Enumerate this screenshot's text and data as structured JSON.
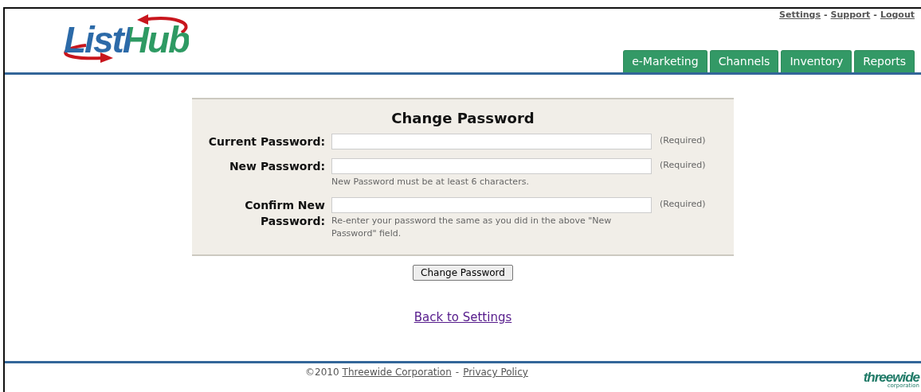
{
  "header": {
    "logo": "ListHub",
    "top_links": [
      {
        "label": "Settings"
      },
      {
        "label": "Support"
      },
      {
        "label": "Logout"
      }
    ],
    "link_separator": "-",
    "tabs": [
      {
        "label": "e-Marketing",
        "selected": false
      },
      {
        "label": "Channels",
        "selected": false
      },
      {
        "label": "Inventory",
        "selected": false
      },
      {
        "label": "Reports",
        "selected": false
      }
    ]
  },
  "form": {
    "title": "Change Password",
    "fields": [
      {
        "label": "Current Password:",
        "required_note": "(Required)"
      },
      {
        "label": "New Password:",
        "required_note": "(Required)",
        "hint": "New Password must be at least 6 characters."
      },
      {
        "label": "Confirm New Password:",
        "required_note": "(Required)",
        "hint": "Re-enter your password the same as you did in the above \"New Password\" field."
      }
    ],
    "submit": "Change Password"
  },
  "back_link": "Back to Settings",
  "footer": {
    "copyright": "©2010",
    "company_link": "Threewide Corporation",
    "separator": "-",
    "policy_link": "Privacy Policy",
    "logo": "threewide",
    "logo_sub": "corporation"
  }
}
